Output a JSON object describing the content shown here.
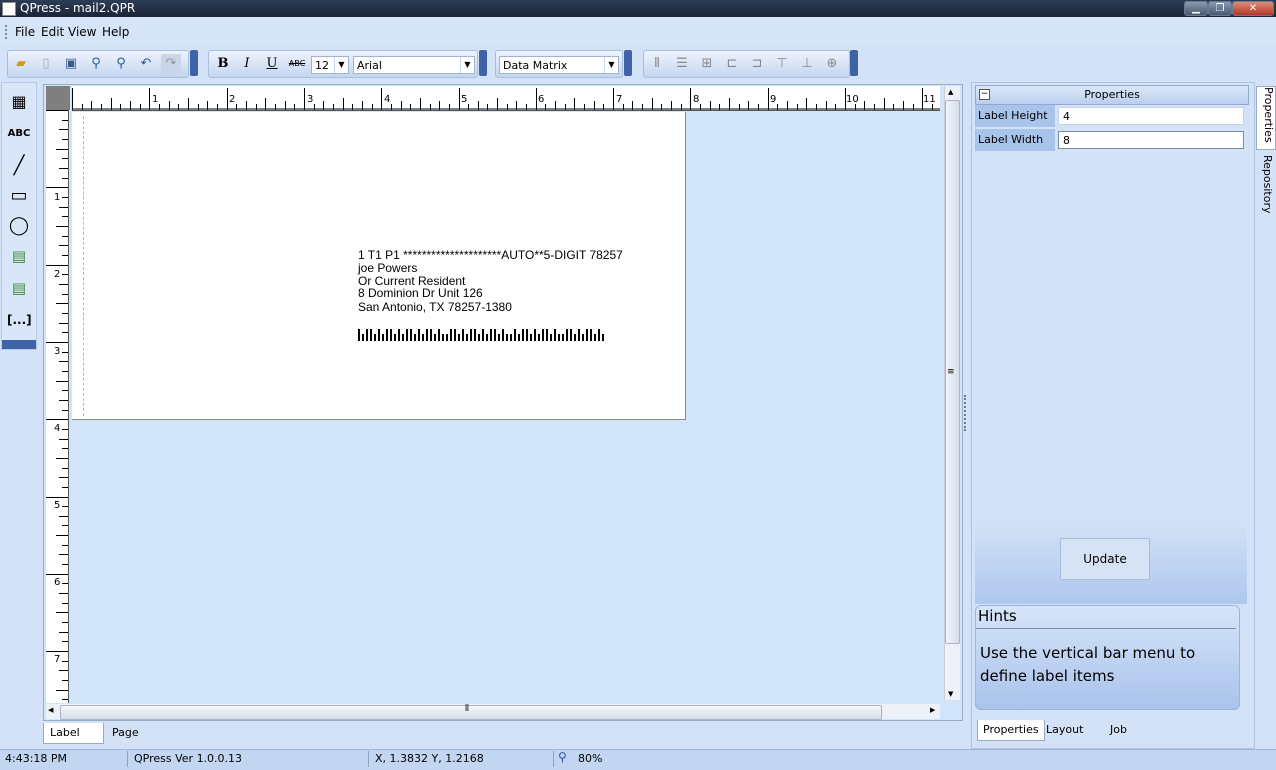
{
  "window": {
    "title": "QPress - mail2.QPR"
  },
  "menu": {
    "items": [
      "File",
      "Edit",
      "View",
      "Help"
    ]
  },
  "toolbar": {
    "font_size": "12",
    "font_name": "Arial",
    "barcode_type": "Data Matrix"
  },
  "rulers": {
    "top_numbers": [
      "1",
      "2",
      "3",
      "4",
      "5",
      "6",
      "7",
      "8",
      "9",
      "10",
      "11"
    ],
    "left_numbers": [
      "1",
      "2",
      "3",
      "4",
      "5",
      "6",
      "7"
    ]
  },
  "label": {
    "lines": [
      "1 T1  P1 *********************AUTO**5-DIGIT 78257",
      "joe Powers",
      "Or Current Resident",
      "8 Dominion Dr Unit 126",
      "San Antonio, TX 78257-1380"
    ]
  },
  "canvas_tabs": [
    "Label",
    "Page"
  ],
  "properties": {
    "header": "Properties",
    "rows": [
      {
        "name": "Label Height",
        "value": "4"
      },
      {
        "name": "Label Width",
        "value": "8"
      }
    ],
    "update_label": "Update"
  },
  "hints": {
    "title": "Hints",
    "text": "Use the vertical bar menu to define label items"
  },
  "side_tabs": [
    "Properties",
    "Repository"
  ],
  "panel_tabs": [
    "Properties",
    "Layout",
    "Job"
  ],
  "status": {
    "time": "4:43:18 PM",
    "version": "QPress Ver 1.0.0.13",
    "coords": "X, 1.3832 Y, 1.2168",
    "zoom": "80%"
  }
}
